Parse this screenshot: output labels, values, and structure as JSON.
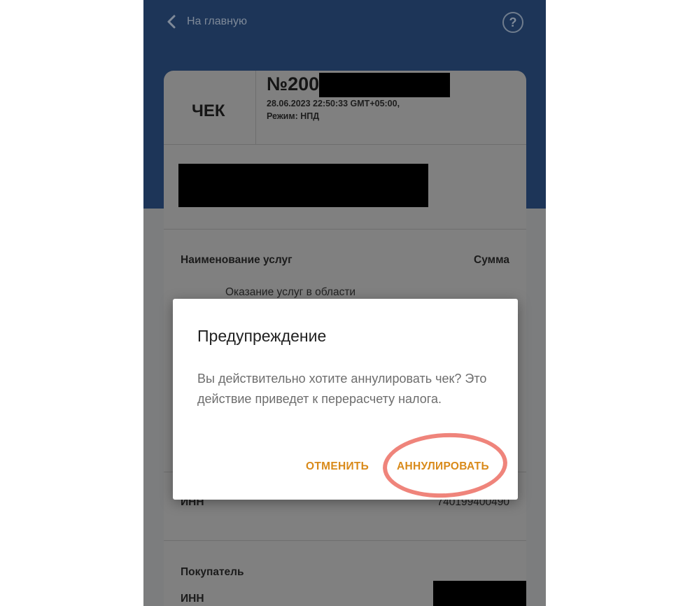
{
  "header": {
    "back_label": "На главную",
    "help_glyph": "?"
  },
  "receipt": {
    "title": "ЧЕК",
    "number": "№200",
    "datetime": "28.06.2023 22:50:33 GMT+05:00,",
    "mode": "Режим: НПД",
    "columns": {
      "service": "Наименование услуг",
      "sum": "Сумма"
    },
    "service_text": "Оказание услуг в области",
    "seller_inn_label": "ИНН",
    "seller_inn_value": "740199400490",
    "buyer_label": "Покупатель",
    "buyer_inn_label": "ИНН"
  },
  "dialog": {
    "title": "Предупреждение",
    "message": "Вы действительно хотите аннулировать чек? Это действие приведет к перерасчету налога.",
    "cancel_label": "ОТМЕНИТЬ",
    "confirm_label": "АННУЛИРОВАТЬ"
  },
  "colors": {
    "header_bg": "#1d3558",
    "button_text": "#d98a1a",
    "highlight_ring": "#ec6e64",
    "redaction": "#000000"
  },
  "icons": [
    "chevron-left-icon",
    "help-icon"
  ]
}
